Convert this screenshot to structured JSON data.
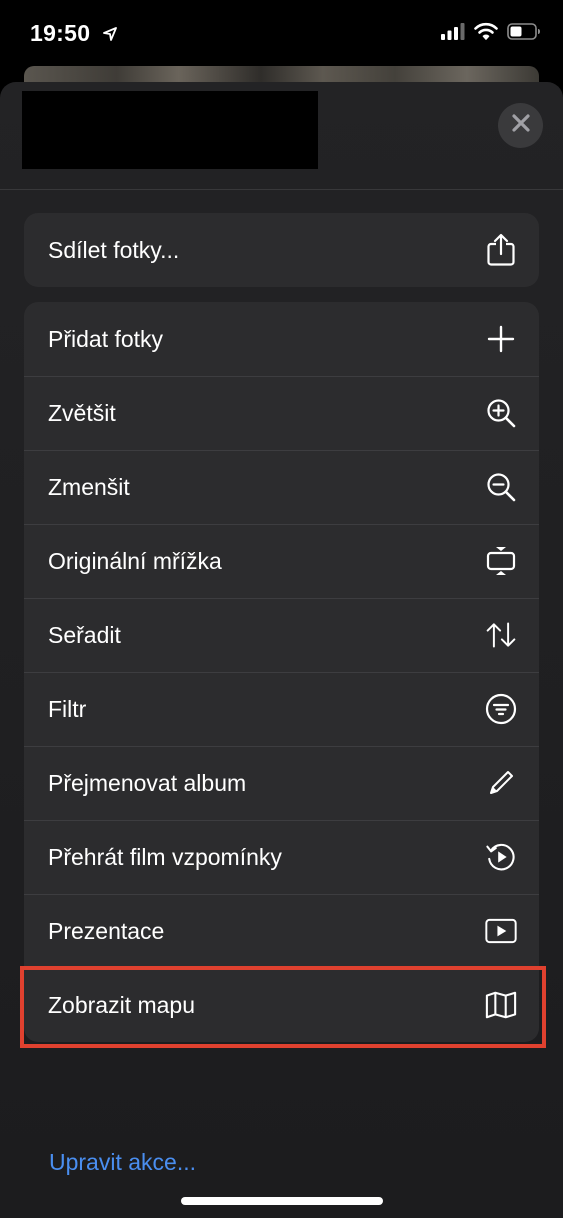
{
  "status_bar": {
    "time": "19:50",
    "icons": [
      "location-arrow-icon",
      "cellular-signal-icon",
      "wifi-icon",
      "battery-icon"
    ]
  },
  "sheet": {
    "close_icon": "close-icon",
    "share_group": [
      {
        "label": "Sdílet fotky...",
        "icon": "share-icon"
      }
    ],
    "menu_items": [
      {
        "label": "Přidat fotky",
        "icon": "plus-icon"
      },
      {
        "label": "Zvětšit",
        "icon": "zoom-in-icon"
      },
      {
        "label": "Zmenšit",
        "icon": "zoom-out-icon"
      },
      {
        "label": "Originální mřížka",
        "icon": "aspect-grid-icon"
      },
      {
        "label": "Seřadit",
        "icon": "sort-arrows-icon"
      },
      {
        "label": "Filtr",
        "icon": "filter-icon"
      },
      {
        "label": "Přejmenovat album",
        "icon": "pencil-icon"
      },
      {
        "label": "Přehrát film vzpomínky",
        "icon": "memory-replay-icon"
      },
      {
        "label": "Prezentace",
        "icon": "play-rectangle-icon"
      },
      {
        "label": "Zobrazit mapu",
        "icon": "map-icon"
      }
    ],
    "highlighted_item": "Zobrazit mapu",
    "edit_actions_label": "Upravit akce..."
  },
  "colors": {
    "sheet_background": "#1c1c1e",
    "group_background": "#2c2c2e",
    "separator": "#3d3d40",
    "link": "#4a8ef0",
    "highlight": "#e0412f"
  }
}
